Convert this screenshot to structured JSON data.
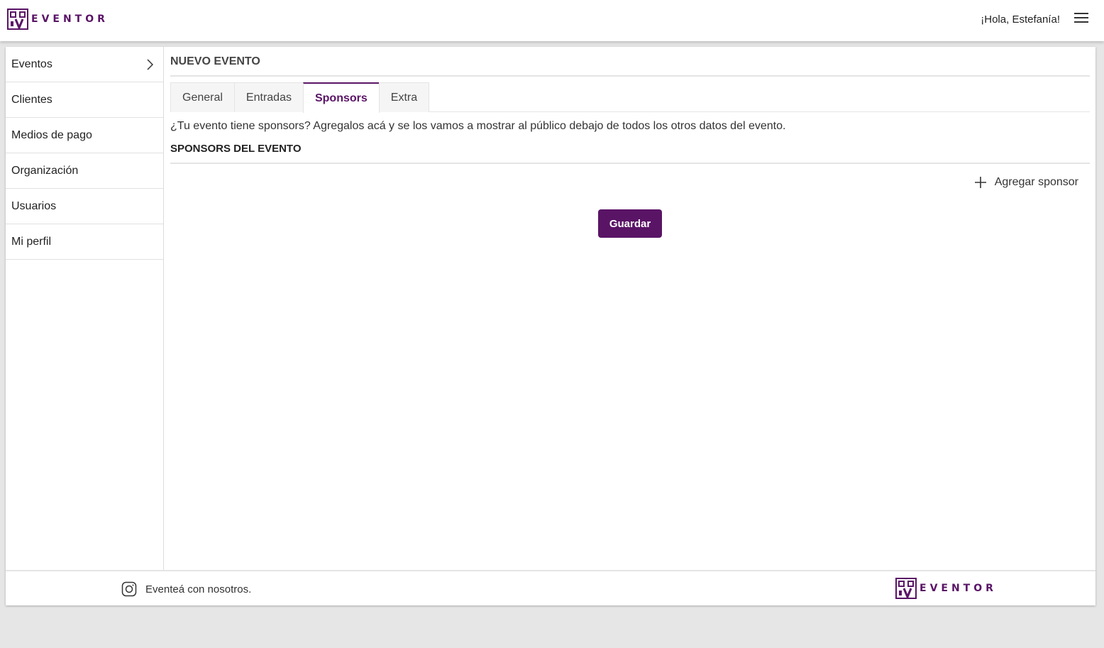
{
  "brand": {
    "name": "EVENTOR",
    "color": "#5a1466"
  },
  "header": {
    "greeting": "¡Hola, Estefanía!",
    "menu_icon": "hamburger-menu-icon"
  },
  "sidebar": {
    "items": [
      {
        "label": "Eventos",
        "icon": "chevron-right-icon"
      },
      {
        "label": "Clientes"
      },
      {
        "label": "Medios de pago"
      },
      {
        "label": "Organización"
      },
      {
        "label": "Usuarios"
      },
      {
        "label": "Mi perfil"
      }
    ]
  },
  "main": {
    "title": "NUEVO EVENTO",
    "tabs": [
      {
        "label": "General",
        "active": false
      },
      {
        "label": "Entradas",
        "active": false
      },
      {
        "label": "Sponsors",
        "active": true
      },
      {
        "label": "Extra",
        "active": false
      }
    ],
    "intro": "¿Tu evento tiene sponsors? Agregalos acá y se los vamos a mostrar al público debajo de todos los otros datos del evento.",
    "section_title": "SPONSORS DEL EVENTO",
    "add_sponsor_label": "Agregar sponsor",
    "save_label": "Guardar"
  },
  "footer": {
    "text": "Eventeá con nosotros.",
    "social_icon": "instagram-icon"
  }
}
